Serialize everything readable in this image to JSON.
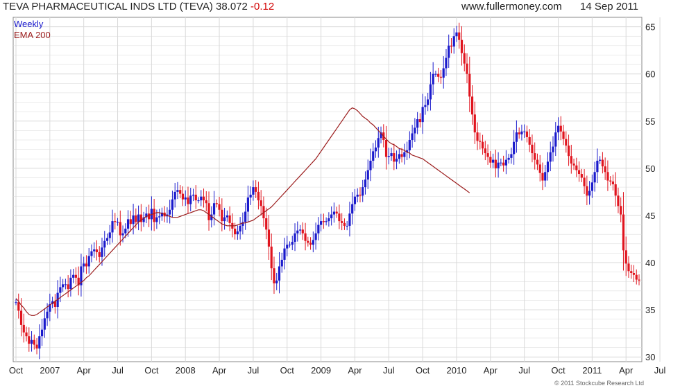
{
  "header": {
    "title": "TEVA PHARMACEUTICAL INDS LTD (TEVA) 38.072",
    "change": "-0.12",
    "site": "www.fullermoney.com",
    "date": "14 Sep 2011"
  },
  "copyright": "© 2011 Stockcube Research Ltd",
  "colors": {
    "up": "#1a1acc",
    "down": "#e0141e",
    "ema": "#9b1c1c",
    "grid": "#d9d9d9"
  },
  "chart_data": {
    "type": "candlestick",
    "legend": [
      "Weekly",
      "EMA 200"
    ],
    "ylim": [
      29.5,
      66
    ],
    "yticks": [
      30,
      35,
      40,
      45,
      50,
      55,
      60,
      65
    ],
    "xtick_labels": [
      "Oct",
      "2007",
      "Apr",
      "Jul",
      "Oct",
      "2008",
      "Apr",
      "Jul",
      "Oct",
      "2009",
      "Apr",
      "Jul",
      "Oct",
      "2010",
      "Apr",
      "Jul",
      "Oct",
      "2011",
      "Apr",
      "Jul"
    ],
    "xtick_weeks": [
      0,
      13,
      26,
      39,
      52,
      65,
      78,
      91,
      104,
      117,
      130,
      143,
      156,
      169,
      182,
      195,
      208,
      221,
      234,
      247
    ],
    "close_weekly": [
      35.8,
      34.9,
      33.4,
      32.6,
      32.2,
      31.4,
      31.8,
      31.3,
      30.9,
      32.2,
      32.9,
      34.1,
      34.8,
      35.6,
      35.9,
      35.3,
      36.8,
      37.4,
      37.7,
      37.7,
      37.2,
      38.4,
      38.7,
      38.4,
      37.6,
      39.6,
      39.9,
      39.6,
      40.7,
      41.2,
      41.4,
      41.1,
      40.6,
      41.6,
      42.3,
      42.6,
      43.2,
      44.4,
      44.3,
      44.3,
      42.9,
      43.1,
      43.6,
      44.6,
      44.1,
      45.0,
      44.3,
      45.1,
      44.3,
      44.8,
      45.2,
      44.6,
      45.7,
      44.3,
      44.8,
      44.9,
      45.3,
      44.9,
      45.1,
      45.6,
      46.7,
      47.5,
      47.7,
      47.3,
      46.7,
      46.9,
      46.2,
      47.1,
      47.2,
      46.6,
      46.6,
      47.0,
      46.6,
      46.3,
      44.5,
      45.1,
      46.3,
      46.2,
      45.6,
      44.4,
      44.8,
      45.0,
      44.2,
      43.6,
      43.0,
      43.3,
      43.9,
      44.3,
      45.4,
      46.9,
      47.2,
      48.0,
      47.5,
      46.6,
      46.0,
      44.7,
      43.5,
      41.7,
      39.4,
      37.8,
      38.1,
      39.6,
      40.3,
      41.5,
      41.9,
      41.9,
      42.2,
      43.1,
      43.4,
      43.5,
      43.1,
      42.3,
      42.1,
      41.9,
      42.4,
      43.1,
      44.0,
      44.4,
      44.3,
      44.4,
      44.7,
      45.1,
      45.4,
      45.2,
      44.4,
      44.2,
      43.9,
      43.9,
      45.2,
      46.2,
      47.0,
      47.2,
      47.1,
      48.0,
      48.8,
      49.8,
      50.8,
      51.8,
      52.2,
      53.2,
      53.8,
      53.0,
      51.2,
      51.3,
      51.6,
      50.7,
      51.0,
      51.5,
      51.2,
      51.7,
      51.9,
      53.0,
      53.7,
      54.3,
      55.2,
      54.9,
      56.5,
      56.7,
      57.3,
      58.9,
      60.0,
      60.0,
      59.7,
      59.6,
      60.6,
      61.7,
      63.0,
      62.9,
      64.0,
      64.4,
      63.6,
      62.2,
      61.1,
      60.0,
      57.6,
      55.7,
      53.8,
      52.9,
      52.8,
      52.1,
      51.6,
      51.2,
      50.6,
      50.9,
      50.0,
      50.6,
      50.6,
      50.3,
      50.9,
      51.1,
      51.5,
      52.8,
      53.8,
      53.6,
      53.9,
      53.9,
      53.3,
      52.5,
      51.6,
      50.9,
      50.4,
      49.5,
      48.7,
      49.6,
      50.7,
      51.7,
      52.3,
      53.8,
      54.5,
      53.9,
      53.1,
      52.4,
      51.3,
      50.5,
      50.3,
      49.8,
      49.4,
      49.0,
      48.1,
      47.1,
      47.6,
      48.5,
      49.6,
      50.8,
      50.9,
      50.2,
      49.6,
      48.7,
      48.6,
      48.3,
      47.1,
      46.0,
      45.1,
      41.3,
      39.9,
      39.1,
      38.9,
      38.7,
      38.2,
      38.1
    ],
    "ema200_weekly": [
      36.2,
      35.9,
      35.5,
      35.2,
      34.8,
      34.5,
      34.4,
      34.4,
      34.5,
      34.7,
      34.9,
      35.1,
      35.3,
      35.5,
      35.7,
      35.9,
      36.1,
      36.3,
      36.5,
      36.7,
      36.9,
      37.1,
      37.3,
      37.5,
      37.7,
      37.9,
      38.1,
      38.4,
      38.6,
      38.9,
      39.2,
      39.5,
      39.8,
      40.1,
      40.4,
      40.7,
      41.0,
      41.3,
      41.6,
      41.9,
      42.2,
      42.5,
      42.8,
      43.1,
      43.4,
      43.7,
      44.0,
      44.3,
      44.5,
      44.7,
      44.9,
      45.0,
      45.1,
      45.2,
      45.3,
      45.3,
      45.2,
      45.1,
      45.0,
      44.9,
      44.8,
      44.8,
      44.8,
      44.9,
      45.0,
      45.1,
      45.2,
      45.3,
      45.4,
      45.5,
      45.6,
      45.6,
      45.5,
      45.3,
      45.1,
      44.9,
      44.7,
      44.5,
      44.3,
      44.1,
      44.0,
      43.9,
      43.9,
      43.9,
      43.9,
      44.0,
      44.1,
      44.2,
      44.2,
      44.3,
      44.4,
      44.5,
      44.7,
      44.9,
      45.1,
      45.3,
      45.5,
      45.7,
      45.9,
      46.2,
      46.5,
      46.8,
      47.1,
      47.4,
      47.7,
      48.0,
      48.3,
      48.6,
      48.9,
      49.2,
      49.5,
      49.8,
      50.1,
      50.4,
      50.7,
      51.0,
      51.4,
      51.8,
      52.2,
      52.6,
      53.0,
      53.4,
      53.8,
      54.2,
      54.6,
      55.0,
      55.4,
      55.8,
      56.2,
      56.4,
      56.3,
      56.1,
      55.8,
      55.5,
      55.3,
      55.1,
      54.8,
      54.6,
      54.3,
      54.0,
      53.7,
      53.4,
      53.1,
      52.8,
      52.6,
      52.5,
      52.3,
      52.1,
      52.0,
      51.9,
      51.7,
      51.6,
      51.4,
      51.3,
      51.2,
      51.1,
      51.0,
      50.8,
      50.6,
      50.4,
      50.2,
      50.0,
      49.8,
      49.6,
      49.4,
      49.2,
      49.0,
      48.8,
      48.6,
      48.4,
      48.2,
      48.0,
      47.8,
      47.6,
      47.4
    ]
  }
}
